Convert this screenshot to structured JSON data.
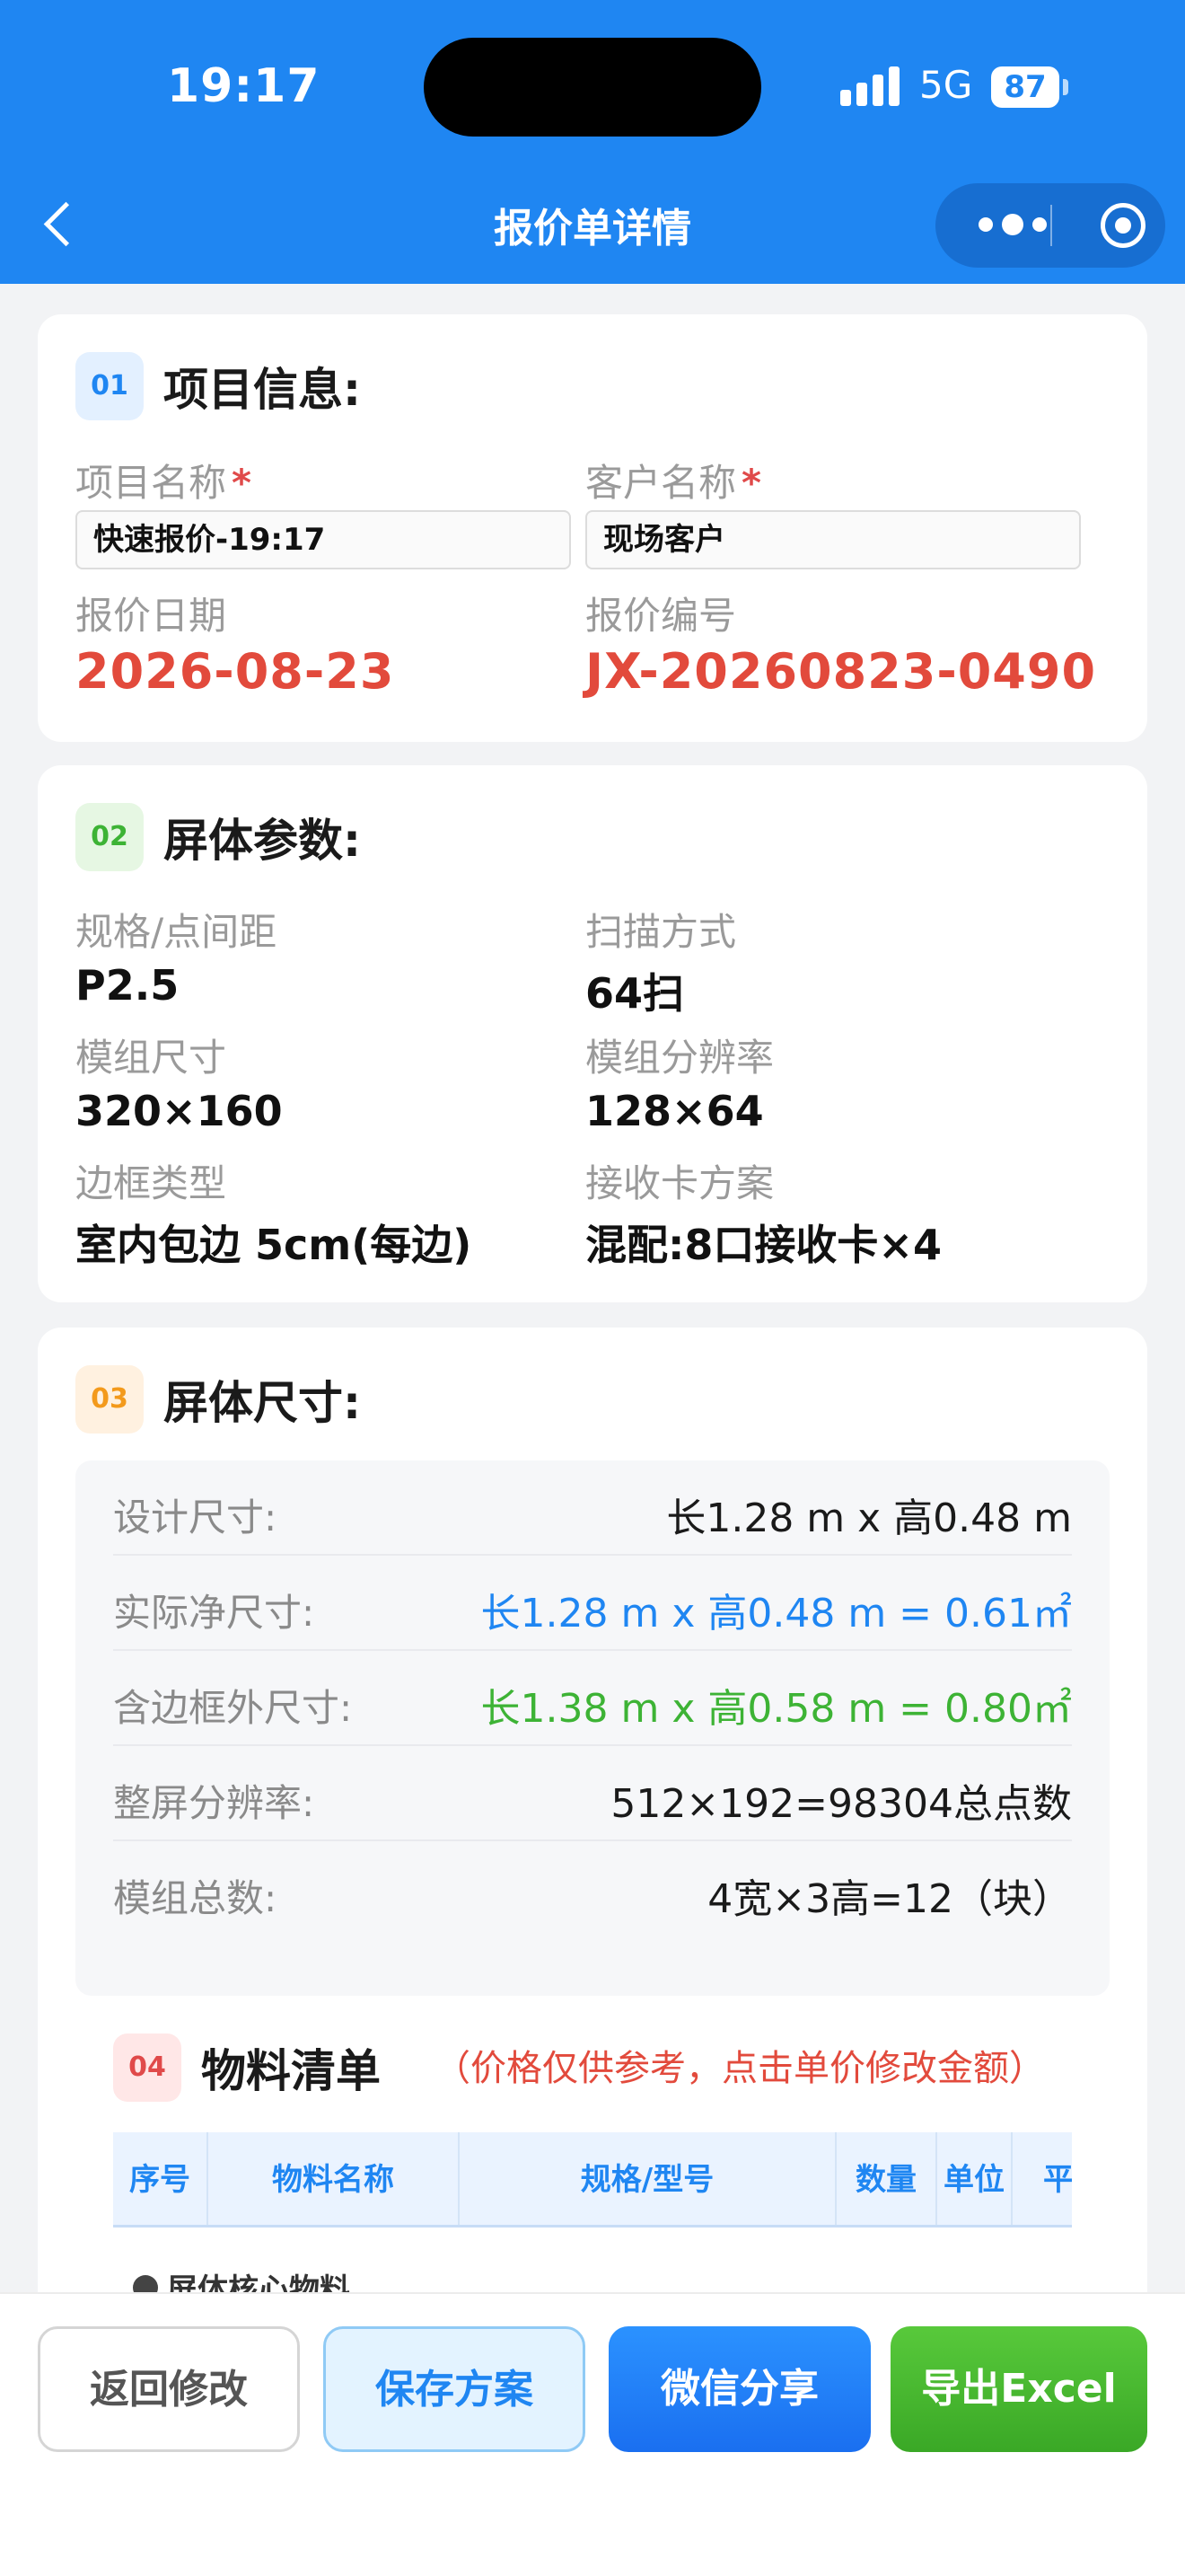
{
  "status_bar": {
    "time": "19:17",
    "network": "5G",
    "battery": "87"
  },
  "nav": {
    "title": "报价单详情"
  },
  "project": {
    "num": "01",
    "title": "项目信息:",
    "name_label": "项目名称",
    "name_value": "快速报价-19:17",
    "customer_label": "客户名称",
    "customer_value": "现场客户",
    "required_mark": "*",
    "date_label": "报价日期",
    "date_value": "2026-08-23",
    "code_label": "报价编号",
    "code_value": "JX-20260823-0490"
  },
  "params": {
    "num": "02",
    "title": "屏体参数:",
    "items": [
      {
        "label": "规格/点间距",
        "value": "P2.5"
      },
      {
        "label": "扫描方式",
        "value": "64扫"
      },
      {
        "label": "模组尺寸",
        "value": "320×160"
      },
      {
        "label": "模组分辨率",
        "value": "128×64"
      },
      {
        "label": "边框类型",
        "value": "室内包边 5cm(每边)"
      },
      {
        "label": "接收卡方案",
        "value": "混配:8口接收卡×4"
      }
    ]
  },
  "size": {
    "num": "03",
    "title": "屏体尺寸:",
    "rows": [
      {
        "label": "设计尺寸:",
        "value": "长1.28 m x 高0.48 m",
        "color": "#1a1a1a"
      },
      {
        "label": "实际净尺寸:",
        "value": "长1.28 m x 高0.48 m = 0.61㎡",
        "color": "#1f86f2"
      },
      {
        "label": "含边框外尺寸:",
        "value": "长1.38 m x 高0.58 m = 0.80㎡",
        "color": "#3db335"
      },
      {
        "label": "整屏分辨率:",
        "value": "512×192=98304总点数",
        "color": "#1a1a1a"
      },
      {
        "label": "模组总数:",
        "value": "4宽×3高=12（块）",
        "color": "#1a1a1a"
      }
    ]
  },
  "materials": {
    "num": "04",
    "title": "物料清单",
    "note": "（价格仅供参考，点击单价修改金额）",
    "columns": [
      "序号",
      "物料名称",
      "规格/型号",
      "数量",
      "单位",
      "平"
    ],
    "group": "屏体核心物料"
  },
  "actions": {
    "back": "返回修改",
    "save": "保存方案",
    "share": "微信分享",
    "export": "导出Excel"
  }
}
